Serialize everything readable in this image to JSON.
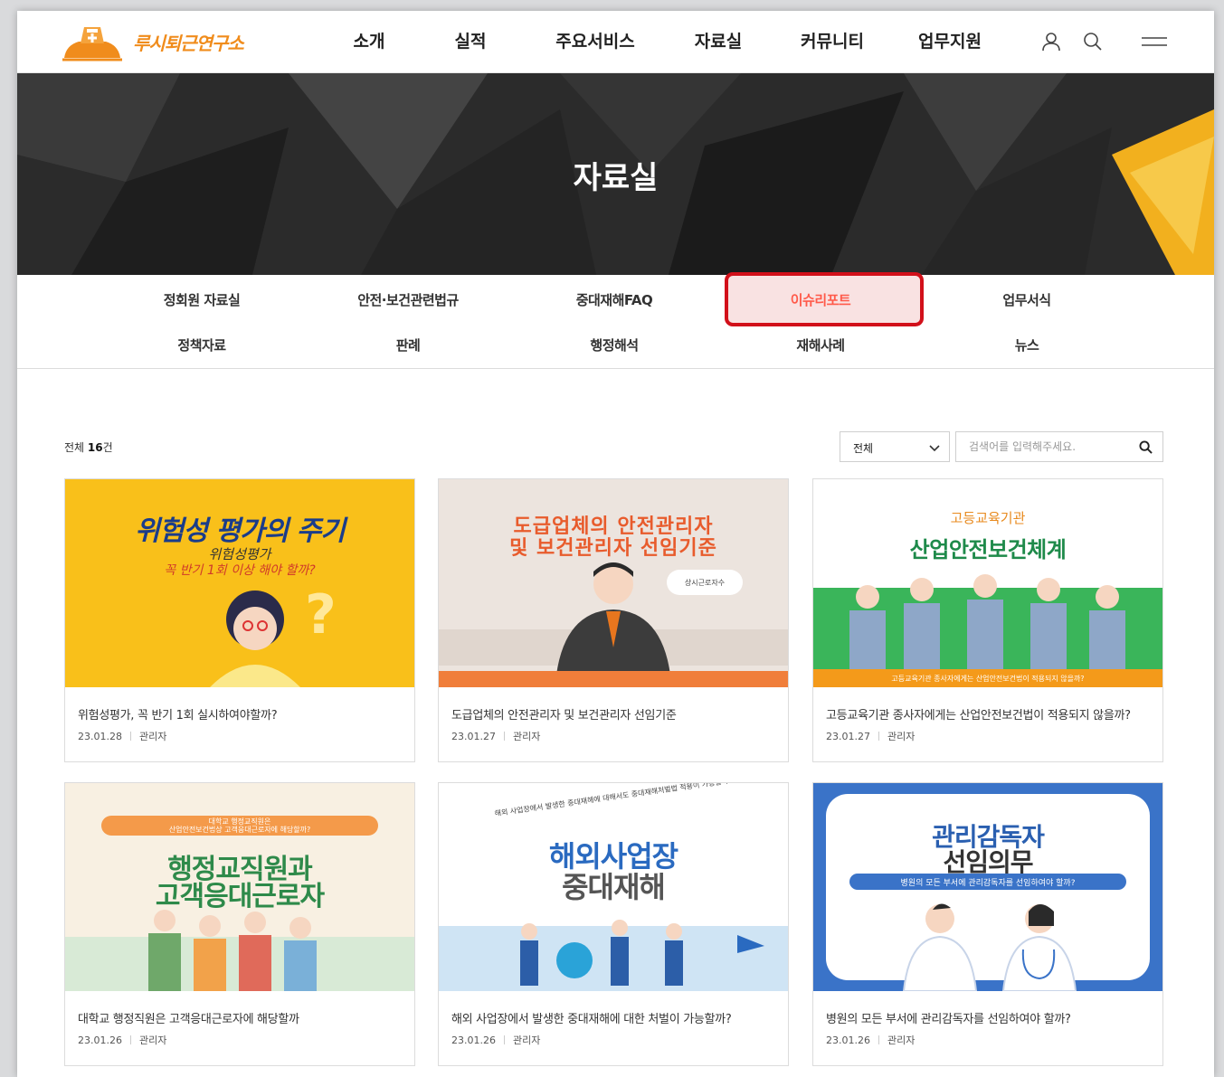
{
  "brand": {
    "name": "루시퇴근연구소"
  },
  "nav": {
    "items": [
      "소개",
      "실적",
      "주요서비스",
      "자료실",
      "커뮤니티",
      "업무지원"
    ]
  },
  "header_icons": [
    "user-icon",
    "search-icon",
    "menu-icon"
  ],
  "hero": {
    "title": "자료실"
  },
  "subnav": {
    "row1": [
      "정회원 자료실",
      "안전·보건관련법규",
      "중대재해FAQ",
      "이슈리포트",
      "업무서식"
    ],
    "row2": [
      "정책자료",
      "판례",
      "행정해석",
      "재해사례",
      "뉴스"
    ],
    "active": "이슈리포트"
  },
  "list": {
    "total_prefix": "전체",
    "total_count": "16",
    "total_suffix": "건",
    "filter_selected": "전체",
    "search_placeholder": "검색어를 입력해주세요."
  },
  "cards": [
    {
      "thumb_lines": [
        "위험성 평가의 주기",
        "위험성평가",
        "꼭 반기 1회 이상 해야 할까?"
      ],
      "title": "위험성평가, 꼭 반기 1회 실시하여야할까?",
      "date": "23.01.28",
      "author": "관리자"
    },
    {
      "thumb_lines": [
        "도급업체의 안전관리자",
        "및 보건관리자 선임기준",
        "상시근로자수"
      ],
      "title": "도급업체의 안전관리자 및 보건관리자 선임기준",
      "date": "23.01.27",
      "author": "관리자"
    },
    {
      "thumb_lines": [
        "고등교육기관",
        "산업안전보건체계",
        "고등교육기관 종사자에게는 산업안전보건법이 적용되지 않을까?"
      ],
      "title": "고등교육기관 종사자에게는 산업안전보건법이 적용되지 않을까?",
      "date": "23.01.27",
      "author": "관리자"
    },
    {
      "thumb_lines": [
        "대학교 행정교직원은",
        "산업안전보건법상 고객응대근로자에 해당할까?",
        "행정교직원과",
        "고객응대근로자"
      ],
      "title": "대학교 행정직원은 고객응대근로자에 해당할까",
      "date": "23.01.26",
      "author": "관리자"
    },
    {
      "thumb_lines": [
        "해외 사업장에서 발생한 중대재해에 대해서도 중대재해처벌법 적용이 가능할까?",
        "해외사업장",
        "중대재해"
      ],
      "title": "해외 사업장에서 발생한 중대재해에 대한 처벌이 가능할까?",
      "date": "23.01.26",
      "author": "관리자"
    },
    {
      "thumb_lines": [
        "관리감독자",
        "선임의무",
        "병원의 모든 부서에 관리감독자를 선임하여야 할까?"
      ],
      "title": "병원의 모든 부서에 관리감독자를 선임하여야 할까?",
      "date": "23.01.26",
      "author": "관리자"
    }
  ],
  "colors": {
    "accent": "#ff5a4a",
    "highlight_border": "#d2101a",
    "logo_orange": "#f08c1c"
  }
}
